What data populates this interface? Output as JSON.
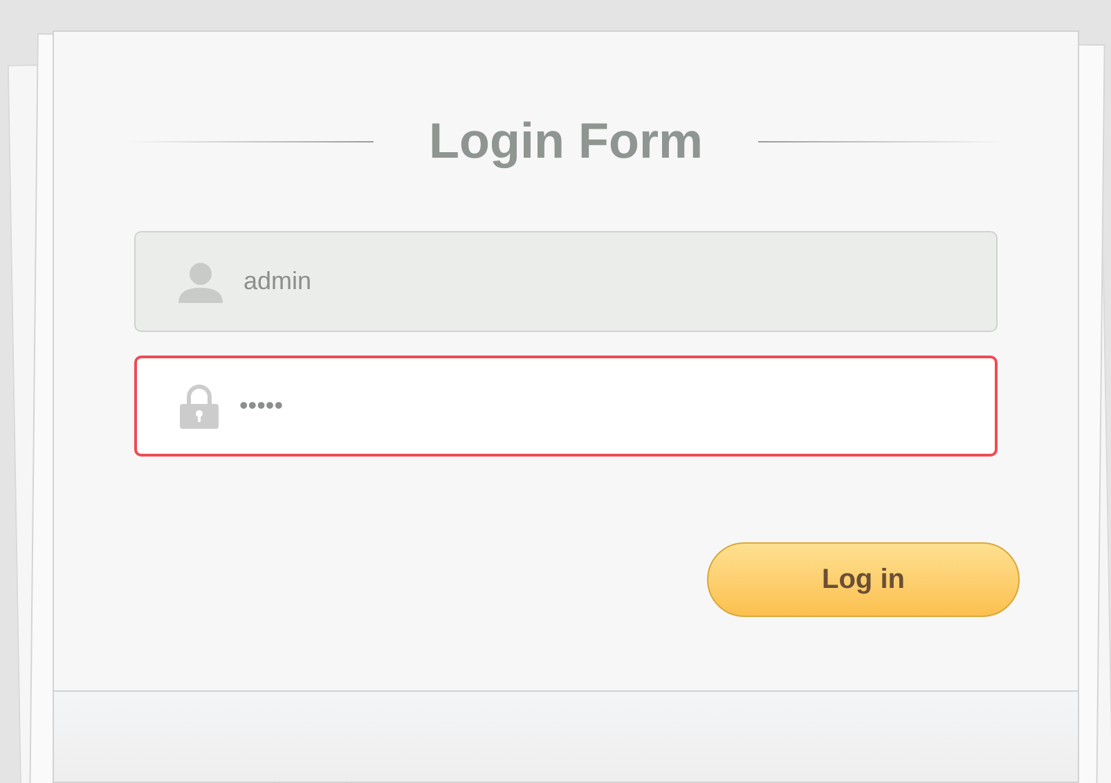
{
  "title": "Login Form",
  "fields": [
    {
      "kind": "user",
      "value": "admin",
      "invalid": false
    },
    {
      "kind": "lock",
      "value": "•••••",
      "invalid": true
    }
  ],
  "button": {
    "label": "Log in"
  }
}
